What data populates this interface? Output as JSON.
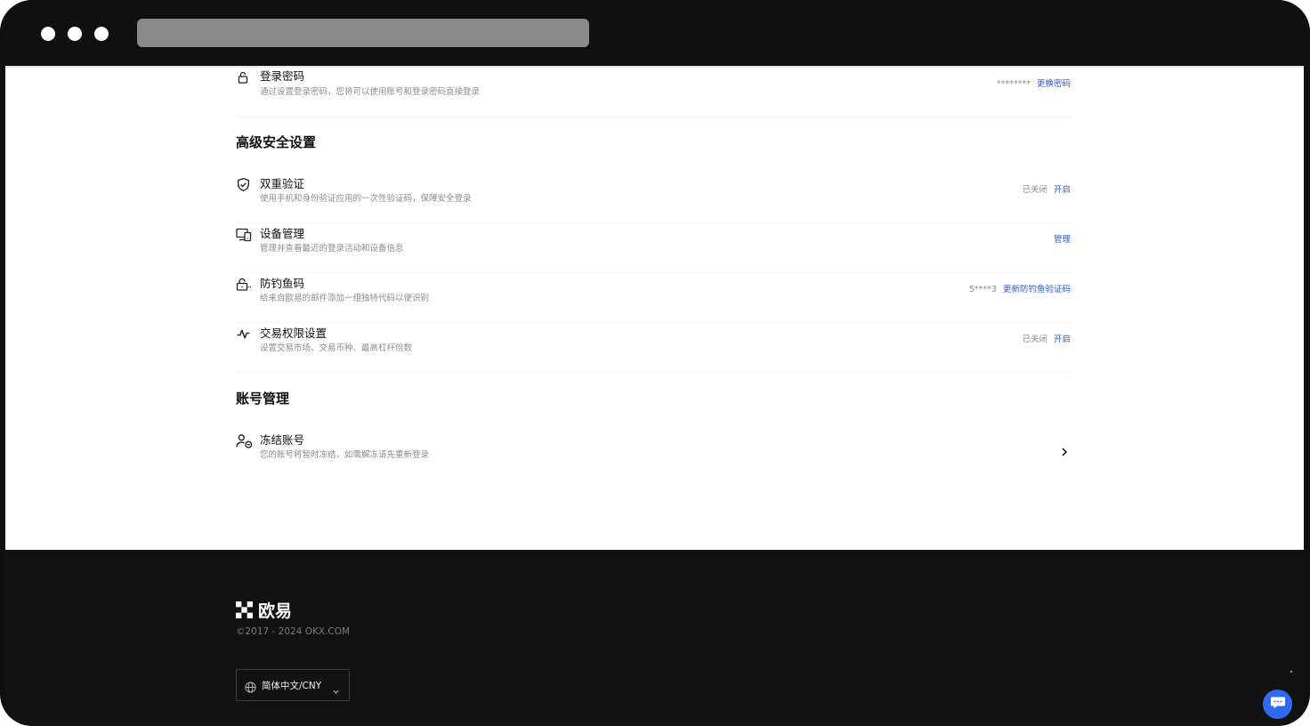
{
  "login_password": {
    "title": "登录密码",
    "desc": "通过设置登录密码，您将可以使用账号和登录密码直接登录",
    "masked_value": "********",
    "action": "更换密码"
  },
  "advanced": {
    "heading": "高级安全设置",
    "items": [
      {
        "icon": "shield-check-icon",
        "title": "双重验证",
        "desc": "使用手机和身份验证应用的一次性验证码，保障安全登录",
        "status": "已关闭",
        "action": "开启"
      },
      {
        "icon": "devices-icon",
        "title": "设备管理",
        "desc": "管理并查看最近的登录活动和设备信息",
        "status": "",
        "action": "管理"
      },
      {
        "icon": "anti-phishing-lock-icon",
        "title": "防钓鱼码",
        "desc": "给来自欧易的邮件添加一组独特代码以便识别",
        "status": "5****3",
        "action": "更新防钓鱼验证码"
      },
      {
        "icon": "activity-icon",
        "title": "交易权限设置",
        "desc": "设置交易市场、交易币种、最高杠杆倍数",
        "status": "已关闭",
        "action": "开启"
      }
    ]
  },
  "account": {
    "heading": "账号管理",
    "freeze": {
      "icon": "user-freeze-icon",
      "title": "冻结账号",
      "desc": "您的账号将暂时冻结，如需解冻请先重新登录"
    }
  },
  "footer": {
    "brand": "欧易",
    "copyright": "©2017 - 2024 OKX.COM",
    "language": "简体中文/CNY"
  },
  "colors": {
    "link": "#2d5bd8",
    "footer_bg": "#121212",
    "chat_button": "#2f6bf2"
  }
}
